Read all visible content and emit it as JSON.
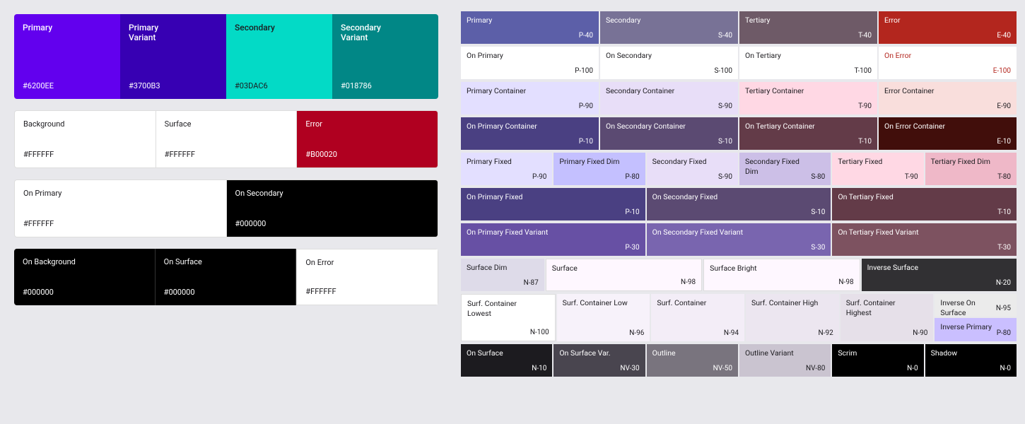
{
  "left": {
    "row1": [
      {
        "label": "Primary",
        "hex": "#6200EE",
        "bg": "#6200EE",
        "color": "white"
      },
      {
        "label": "Primary\nVariant",
        "hex": "#3700B3",
        "bg": "#3700B3",
        "color": "white"
      },
      {
        "label": "Secondary",
        "hex": "#03DAC6",
        "bg": "#03DAC6",
        "color": "#1C1B1F"
      },
      {
        "label": "Secondary\nVariant",
        "hex": "#018786",
        "bg": "#018786",
        "color": "white"
      }
    ],
    "row2": [
      {
        "label": "Background",
        "hex": "#FFFFFF",
        "bg": "#FFFFFF",
        "color": "#1C1B1F"
      },
      {
        "label": "Surface",
        "hex": "#FFFFFF",
        "bg": "#FFFFFF",
        "color": "#1C1B1F"
      },
      {
        "label": "Error",
        "hex": "#B00020",
        "bg": "#B00020",
        "color": "white"
      }
    ],
    "row3": [
      {
        "label": "On Primary",
        "hex": "#FFFFFF",
        "bg": "#FFFFFF",
        "color": "#1C1B1F"
      },
      {
        "label": "On Secondary",
        "hex": "#000000",
        "bg": "#000000",
        "color": "white"
      }
    ],
    "row4": [
      {
        "label": "On Background",
        "hex": "#000000",
        "bg": "#000000",
        "color": "white"
      },
      {
        "label": "On Surface",
        "hex": "#000000",
        "bg": "#000000",
        "color": "white"
      },
      {
        "label": "On Error",
        "hex": "#FFFFFF",
        "bg": "#FFFFFF",
        "color": "#1C1B1F"
      }
    ]
  },
  "right": {
    "row1": [
      {
        "label": "Primary",
        "code": "P-40",
        "cls": "bg-primary"
      },
      {
        "label": "Secondary",
        "code": "S-40",
        "cls": "bg-secondary"
      },
      {
        "label": "Tertiary",
        "code": "T-40",
        "cls": "bg-tertiary"
      },
      {
        "label": "Error",
        "code": "E-40",
        "cls": "bg-error"
      }
    ],
    "row2": [
      {
        "label": "On Primary",
        "code": "P-100",
        "cls": "bg-on-primary"
      },
      {
        "label": "On Secondary",
        "code": "S-100",
        "cls": "bg-on-secondary"
      },
      {
        "label": "On Tertiary",
        "code": "T-100",
        "cls": "bg-on-tertiary"
      },
      {
        "label": "On Error",
        "code": "E-100",
        "cls": "bg-on-error"
      }
    ],
    "row3": [
      {
        "label": "Primary Container",
        "code": "P-90",
        "cls": "bg-primary-container"
      },
      {
        "label": "Secondary Container",
        "code": "S-90",
        "cls": "bg-secondary-container"
      },
      {
        "label": "Tertiary Container",
        "code": "T-90",
        "cls": "bg-tertiary-container"
      },
      {
        "label": "Error Container",
        "code": "E-90",
        "cls": "bg-error-container"
      }
    ],
    "row4": [
      {
        "label": "On Primary Container",
        "code": "P-10",
        "cls": "bg-on-primary-container"
      },
      {
        "label": "On Secondary Container",
        "code": "S-10",
        "cls": "bg-on-secondary-container"
      },
      {
        "label": "On Tertiary Container",
        "code": "T-10",
        "cls": "bg-on-tertiary-container"
      },
      {
        "label": "On Error Container",
        "code": "E-10",
        "cls": "bg-on-error-container"
      }
    ],
    "row5": [
      {
        "label": "Primary Fixed",
        "code": "P-90",
        "cls": "bg-primary-fixed"
      },
      {
        "label": "Primary Fixed Dim",
        "code": "P-80",
        "cls": "bg-primary-fixed-dim"
      },
      {
        "label": "Secondary Fixed",
        "code": "S-90",
        "cls": "bg-secondary-fixed"
      },
      {
        "label": "Secondary Fixed Dim",
        "code": "S-80",
        "cls": "bg-secondary-fixed-dim"
      },
      {
        "label": "Tertiary Fixed",
        "code": "T-90",
        "cls": "bg-tertiary-fixed"
      },
      {
        "label": "Tertiary Fixed Dim",
        "code": "T-80",
        "cls": "bg-tertiary-fixed-dim"
      }
    ],
    "row6": [
      {
        "label": "On Primary Fixed",
        "code": "P-10",
        "cls": "bg-on-primary-fixed",
        "span": 2
      },
      {
        "label": "On Secondary Fixed",
        "code": "S-10",
        "cls": "bg-on-secondary-fixed",
        "span": 2
      },
      {
        "label": "On Tertiary Fixed",
        "code": "T-10",
        "cls": "bg-on-tertiary-fixed",
        "span": 2
      }
    ],
    "row7": [
      {
        "label": "On Primary Fixed Variant",
        "code": "P-30",
        "cls": "bg-on-primary-fixed-var",
        "span": 2
      },
      {
        "label": "On Secondary Fixed Variant",
        "code": "S-30",
        "cls": "bg-on-secondary-fixed-var",
        "span": 2
      },
      {
        "label": "On Tertiary Fixed Variant",
        "code": "T-30",
        "cls": "bg-on-tertiary-fixed-var",
        "span": 2
      }
    ],
    "row8": [
      {
        "label": "Surface Dim",
        "code": "N-87",
        "cls": "bg-surface-dim"
      },
      {
        "label": "Surface",
        "code": "N-98",
        "cls": "bg-surface",
        "wide": true
      },
      {
        "label": "Surface Bright",
        "code": "N-98",
        "cls": "bg-surface-bright",
        "wide": true
      },
      {
        "label": "Inverse Surface",
        "code": "N-20",
        "cls": "bg-inverse-surface"
      }
    ],
    "row9": [
      {
        "label": "Surf. Container Lowest",
        "code": "N-100",
        "cls": "bg-surf-container-lowest"
      },
      {
        "label": "Surf. Container Low",
        "code": "N-96",
        "cls": "bg-surf-container-low"
      },
      {
        "label": "Surf. Container",
        "code": "N-94",
        "cls": "bg-surf-container"
      },
      {
        "label": "Surf. Container High",
        "code": "N-92",
        "cls": "bg-surf-container-high"
      },
      {
        "label": "Surf. Container Highest",
        "code": "N-90",
        "cls": "bg-surf-container-highest"
      },
      {
        "label": "Inverse On Surface",
        "code": "N-95",
        "cls": "bg-inverse-on-surface"
      },
      {
        "label": "Inverse Primary",
        "code": "P-80",
        "cls": "bg-inverse-primary"
      }
    ],
    "row10": [
      {
        "label": "On Surface",
        "code": "N-10",
        "cls": "bg-on-surface"
      },
      {
        "label": "On Surface Var.",
        "code": "NV-30",
        "cls": "bg-on-surface-var"
      },
      {
        "label": "Outline",
        "code": "NV-50",
        "cls": "bg-outline"
      },
      {
        "label": "Outline Variant",
        "code": "NV-80",
        "cls": "bg-outline-var"
      },
      {
        "label": "Scrim",
        "code": "N-0",
        "cls": "bg-scrim"
      },
      {
        "label": "Shadow",
        "code": "N-0",
        "cls": "bg-shadow"
      }
    ]
  }
}
